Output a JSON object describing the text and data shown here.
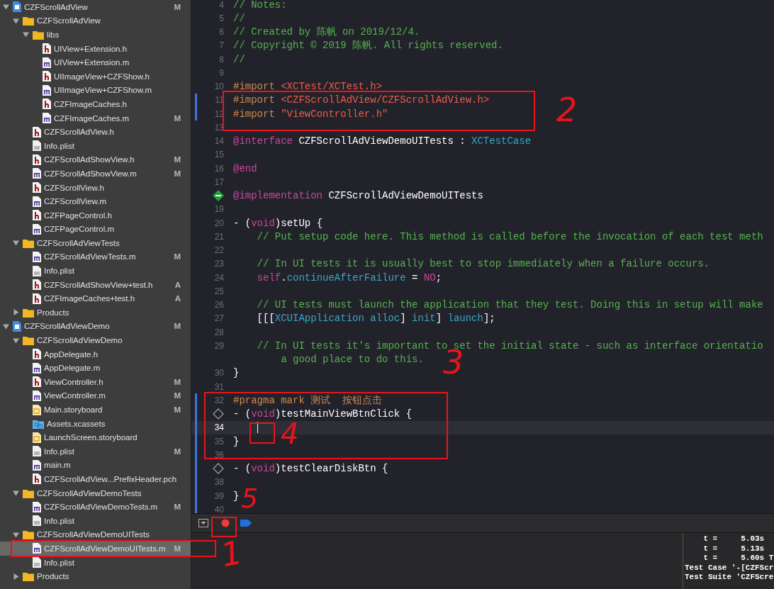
{
  "sidebar": {
    "items": [
      {
        "name": "CZFScrollAdView",
        "kind": "project",
        "status": "M",
        "expanded": true,
        "selected": false,
        "children": [
          {
            "name": "CZFScrollAdView",
            "kind": "folder",
            "expanded": true,
            "selected": false,
            "children": [
              {
                "name": "libs",
                "kind": "folder",
                "expanded": true,
                "selected": false,
                "children": [
                  {
                    "name": "UIView+Extension.h",
                    "kind": "h",
                    "selected": false
                  },
                  {
                    "name": "UIView+Extension.m",
                    "kind": "m",
                    "selected": false
                  },
                  {
                    "name": "UIImageView+CZFShow.h",
                    "kind": "h",
                    "selected": false
                  },
                  {
                    "name": "UIImageView+CZFShow.m",
                    "kind": "m",
                    "selected": false
                  },
                  {
                    "name": "CZFImageCaches.h",
                    "kind": "h",
                    "selected": false
                  },
                  {
                    "name": "CZFImageCaches.m",
                    "kind": "m",
                    "status": "M",
                    "selected": false
                  }
                ]
              },
              {
                "name": "CZFScrollAdView.h",
                "kind": "h",
                "selected": false
              },
              {
                "name": "Info.plist",
                "kind": "plist",
                "selected": false
              },
              {
                "name": "CZFScrollAdShowView.h",
                "kind": "h",
                "status": "M",
                "selected": false
              },
              {
                "name": "CZFScrollAdShowView.m",
                "kind": "m",
                "status": "M",
                "selected": false
              },
              {
                "name": "CZFScrollView.h",
                "kind": "h",
                "selected": false
              },
              {
                "name": "CZFScrollView.m",
                "kind": "m",
                "selected": false
              },
              {
                "name": "CZFPageControl.h",
                "kind": "h",
                "selected": false
              },
              {
                "name": "CZFPageControl.m",
                "kind": "m",
                "selected": false
              }
            ]
          },
          {
            "name": "CZFScrollAdViewTests",
            "kind": "folder",
            "expanded": true,
            "selected": false,
            "children": [
              {
                "name": "CZFScrollAdViewTests.m",
                "kind": "m",
                "status": "M",
                "selected": false
              },
              {
                "name": "Info.plist",
                "kind": "plist",
                "selected": false
              },
              {
                "name": "CZFScrollAdShowView+test.h",
                "kind": "h",
                "status": "A",
                "selected": false
              },
              {
                "name": "CZFImageCaches+test.h",
                "kind": "h",
                "status": "A",
                "selected": false
              }
            ]
          },
          {
            "name": "Products",
            "kind": "folder",
            "expanded": false,
            "selected": false
          }
        ]
      },
      {
        "name": "CZFScrollAdViewDemo",
        "kind": "project",
        "status": "M",
        "expanded": true,
        "selected": false,
        "children": [
          {
            "name": "CZFScrollAdViewDemo",
            "kind": "folder",
            "expanded": true,
            "selected": false,
            "children": [
              {
                "name": "AppDelegate.h",
                "kind": "h",
                "selected": false
              },
              {
                "name": "AppDelegate.m",
                "kind": "m",
                "selected": false
              },
              {
                "name": "ViewController.h",
                "kind": "h",
                "status": "M",
                "selected": false
              },
              {
                "name": "ViewController.m",
                "kind": "m",
                "status": "M",
                "selected": false
              },
              {
                "name": "Main.storyboard",
                "kind": "storyboard",
                "status": "M",
                "selected": false
              },
              {
                "name": "Assets.xcassets",
                "kind": "xcassets",
                "selected": false
              },
              {
                "name": "LaunchScreen.storyboard",
                "kind": "storyboard",
                "selected": false
              },
              {
                "name": "Info.plist",
                "kind": "plist",
                "status": "M",
                "selected": false
              },
              {
                "name": "main.m",
                "kind": "m",
                "selected": false
              },
              {
                "name": "CZFScrollAdView...PrefixHeader.pch",
                "kind": "h",
                "selected": false
              }
            ]
          },
          {
            "name": "CZFScrollAdViewDemoTests",
            "kind": "folder",
            "expanded": true,
            "selected": false,
            "children": [
              {
                "name": "CZFScrollAdViewDemoTests.m",
                "kind": "m",
                "status": "M",
                "selected": false
              },
              {
                "name": "Info.plist",
                "kind": "plist",
                "selected": false
              }
            ]
          },
          {
            "name": "CZFScrollAdViewDemoUITests",
            "kind": "folder",
            "expanded": true,
            "selected": false,
            "children": [
              {
                "name": "CZFScrollAdViewDemoUITests.m",
                "kind": "m",
                "status": "M",
                "selected": true
              },
              {
                "name": "Info.plist",
                "kind": "plist",
                "selected": false
              }
            ]
          },
          {
            "name": "Products",
            "kind": "folder",
            "expanded": false,
            "selected": false
          }
        ]
      }
    ]
  },
  "editor": {
    "lines": [
      {
        "number": "4",
        "changed": false,
        "current": false,
        "tokens": [
          {
            "kind": "comment",
            "text": "// Notes:"
          }
        ]
      },
      {
        "number": "5",
        "changed": false,
        "current": false,
        "tokens": [
          {
            "kind": "comment",
            "text": "//"
          }
        ]
      },
      {
        "number": "6",
        "changed": false,
        "current": false,
        "tokens": [
          {
            "kind": "comment",
            "text": "// Created by 陈帆 on 2019/12/4."
          }
        ]
      },
      {
        "number": "7",
        "changed": false,
        "current": false,
        "tokens": [
          {
            "kind": "comment",
            "text": "// Copyright © 2019 陈帆. All rights reserved."
          }
        ]
      },
      {
        "number": "8",
        "changed": false,
        "current": false,
        "tokens": [
          {
            "kind": "comment",
            "text": "//"
          }
        ]
      },
      {
        "number": "9",
        "changed": false,
        "current": false
      },
      {
        "number": "10",
        "changed": false,
        "current": false,
        "tokens": [
          {
            "kind": "preprocessor",
            "text": "#import "
          },
          {
            "kind": "string",
            "text": "<XCTest/XCTest.h>"
          }
        ]
      },
      {
        "number": "11",
        "changed": true,
        "current": false,
        "tokens": [
          {
            "kind": "preprocessor",
            "text": "#import "
          },
          {
            "kind": "string",
            "text": "<CZFScrollAdView/CZFScrollAdView.h>"
          }
        ]
      },
      {
        "number": "12",
        "changed": true,
        "current": false,
        "tokens": [
          {
            "kind": "preprocessor",
            "text": "#import "
          },
          {
            "kind": "string",
            "text": "\"ViewController.h\""
          }
        ]
      },
      {
        "number": "13",
        "changed": false,
        "current": false
      },
      {
        "number": "14",
        "changed": false,
        "current": false,
        "tokens": [
          {
            "kind": "keyword",
            "text": "@interface"
          },
          {
            "kind": "plain",
            "text": " CZFScrollAdViewDemoUITests : "
          },
          {
            "kind": "type",
            "text": "XCTestCase"
          }
        ]
      },
      {
        "number": "15",
        "changed": false,
        "current": false
      },
      {
        "number": "16",
        "changed": false,
        "current": false,
        "tokens": [
          {
            "kind": "keyword",
            "text": "@end"
          }
        ]
      },
      {
        "number": "17",
        "changed": false,
        "current": false
      },
      {
        "tested": true,
        "changed": false,
        "current": false,
        "tokens": [
          {
            "kind": "keyword",
            "text": "@implementation"
          },
          {
            "kind": "plain",
            "text": " CZFScrollAdViewDemoUITests"
          }
        ]
      },
      {
        "number": "19",
        "changed": false,
        "current": false
      },
      {
        "number": "20",
        "changed": false,
        "current": false,
        "tokens": [
          {
            "kind": "plain",
            "text": "- ("
          },
          {
            "kind": "keyword",
            "text": "void"
          },
          {
            "kind": "plain",
            "text": ")setUp {"
          }
        ]
      },
      {
        "number": "21",
        "changed": false,
        "current": false,
        "tokens": [
          {
            "kind": "comment",
            "text": "    // Put setup code here. This method is called before the invocation of each test meth"
          }
        ]
      },
      {
        "number": "22",
        "changed": false,
        "current": false
      },
      {
        "number": "23",
        "changed": false,
        "current": false,
        "tokens": [
          {
            "kind": "comment",
            "text": "    // In UI tests it is usually best to stop immediately when a failure occurs."
          }
        ]
      },
      {
        "number": "24",
        "changed": false,
        "current": false,
        "tokens": [
          {
            "kind": "keyword",
            "text": "    self"
          },
          {
            "kind": "plain",
            "text": "."
          },
          {
            "kind": "type",
            "text": "continueAfterFailure"
          },
          {
            "kind": "plain",
            "text": " = "
          },
          {
            "kind": "keyword",
            "text": "NO"
          },
          {
            "kind": "plain",
            "text": ";"
          }
        ]
      },
      {
        "number": "25",
        "changed": false,
        "current": false
      },
      {
        "number": "26",
        "changed": false,
        "current": false,
        "tokens": [
          {
            "kind": "comment",
            "text": "    // UI tests must launch the application that they test. Doing this in setup will make"
          }
        ]
      },
      {
        "number": "27",
        "changed": false,
        "current": false,
        "tokens": [
          {
            "kind": "plain",
            "text": "    [[["
          },
          {
            "kind": "type",
            "text": "XCUIApplication"
          },
          {
            "kind": "type",
            "text": " alloc"
          },
          {
            "kind": "plain",
            "text": "] "
          },
          {
            "kind": "type",
            "text": "init"
          },
          {
            "kind": "plain",
            "text": "] "
          },
          {
            "kind": "type",
            "text": "launch"
          },
          {
            "kind": "plain",
            "text": "];"
          }
        ]
      },
      {
        "number": "28",
        "changed": false,
        "current": false
      },
      {
        "number": "29",
        "changed": false,
        "current": false,
        "tokens": [
          {
            "kind": "comment",
            "text": "    // In UI tests it's important to set the initial state - such as interface orientatio"
          }
        ],
        "continuation": [
          {
            "kind": "comment",
            "text": "        a good place to do this."
          }
        ]
      },
      {
        "number": "30",
        "changed": false,
        "current": false,
        "tokens": [
          {
            "kind": "plain",
            "text": "}"
          }
        ]
      },
      {
        "number": "31",
        "changed": false,
        "current": false
      },
      {
        "number": "32",
        "changed": true,
        "current": false,
        "tokens": [
          {
            "kind": "preprocessor",
            "text": "#pragma mark 测试  按钮点击"
          }
        ]
      },
      {
        "tested": false,
        "changed": true,
        "current": false,
        "tokens": [
          {
            "kind": "plain",
            "text": "- ("
          },
          {
            "kind": "keyword",
            "text": "void"
          },
          {
            "kind": "plain",
            "text": ")testMainViewBtnClick {"
          }
        ]
      },
      {
        "number": "34",
        "changed": true,
        "current": true
      },
      {
        "number": "35",
        "changed": true,
        "current": false,
        "tokens": [
          {
            "kind": "plain",
            "text": "}"
          }
        ]
      },
      {
        "number": "36",
        "changed": true,
        "current": false
      },
      {
        "tested": false,
        "changed": true,
        "current": false,
        "tokens": [
          {
            "kind": "plain",
            "text": "- ("
          },
          {
            "kind": "keyword",
            "text": "void"
          },
          {
            "kind": "plain",
            "text": ")testClearDiskBtn {"
          }
        ]
      },
      {
        "number": "38",
        "changed": true,
        "current": false
      },
      {
        "number": "39",
        "changed": true,
        "current": false,
        "tokens": [
          {
            "kind": "plain",
            "text": "}"
          }
        ]
      },
      {
        "number": "40",
        "changed": true,
        "current": false
      }
    ]
  },
  "console": {
    "lines": [
      "    t =     5.03s",
      "    t =     5.13s",
      "    t =     5.60s T",
      "Test Case '-[CZFScr",
      "Test Suite 'CZFScre"
    ]
  },
  "annotations": [
    "1",
    "2",
    "3",
    "4",
    "5"
  ]
}
